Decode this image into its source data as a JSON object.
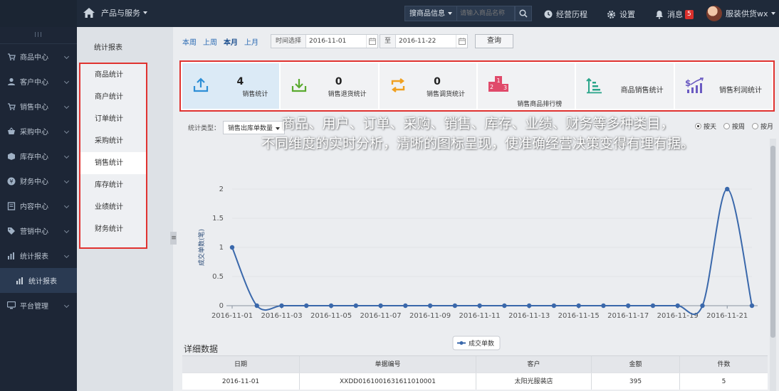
{
  "topbar": {
    "nav_label": "产品与服务",
    "search_category": "搜商品信息",
    "search_placeholder": "请输入商品名称",
    "history_label": "经营历程",
    "settings_label": "设置",
    "messages_label": "消息",
    "messages_count": "5",
    "user_name": "服装供货wx"
  },
  "sidebar": {
    "grip": "III",
    "items": [
      {
        "label": "商品中心",
        "icon": "cart-icon"
      },
      {
        "label": "客户中心",
        "icon": "user-icon"
      },
      {
        "label": "销售中心",
        "icon": "shopping-icon"
      },
      {
        "label": "采购中心",
        "icon": "basket-icon"
      },
      {
        "label": "库存中心",
        "icon": "box-icon"
      },
      {
        "label": "财务中心",
        "icon": "yen-icon"
      },
      {
        "label": "内容中心",
        "icon": "doc-icon"
      },
      {
        "label": "营销中心",
        "icon": "tag-icon"
      },
      {
        "label": "统计报表",
        "icon": "chart-icon"
      }
    ],
    "sub_item": "统计报表",
    "last_item": "平台管理"
  },
  "submenu": {
    "title": "统计报表",
    "items": [
      "商品统计",
      "商户统计",
      "订单统计",
      "采购统计",
      "销售统计",
      "库存统计",
      "业绩统计",
      "财务统计"
    ],
    "active_index": 4
  },
  "filters": {
    "quick": [
      "本周",
      "上周",
      "本月",
      "上月"
    ],
    "active_quick": "本月",
    "date_label": "时间选择",
    "start_date": "2016-11-01",
    "to_label": "至",
    "end_date": "2016-11-22",
    "query_label": "查询"
  },
  "stats": [
    {
      "value": "4",
      "label": "销售统计",
      "icon": "upload-icon",
      "color": "#2e8fd6"
    },
    {
      "value": "0",
      "label": "销售退货统计",
      "icon": "download-icon",
      "color": "#5aaa2f"
    },
    {
      "value": "0",
      "label": "销售调货统计",
      "icon": "swap-icon",
      "color": "#f0a020"
    },
    {
      "value": "",
      "label": "销售商品排行榜",
      "icon": "podium-icon",
      "color": "#e04a6a"
    },
    {
      "value": "",
      "label": "商品销售统计",
      "icon": "bar-sort-icon",
      "color": "#2aa58a"
    },
    {
      "value": "",
      "label": "销售利润统计",
      "icon": "profit-icon",
      "color": "#6b5bc2"
    }
  ],
  "type_row": {
    "label": "统计类型：",
    "selected": "销售出库单数量"
  },
  "radios": [
    {
      "label": "按天",
      "checked": true
    },
    {
      "label": "按周",
      "checked": false
    },
    {
      "label": "按月",
      "checked": false
    }
  ],
  "overlay": {
    "line1": "商品、用户、订单、采购、销售、库存、业绩、财务等多种类目，",
    "line2": "不同维度的实时分析，清晰的图标呈现，使准确经营决策变得有理有据。"
  },
  "chart_data": {
    "type": "line",
    "title": "",
    "ylabel": "成交单数(笔)",
    "xlabel": "",
    "legend": "成交单数",
    "ylim": [
      0,
      2
    ],
    "yticks": [
      0,
      0.5,
      1,
      1.5,
      2
    ],
    "x": [
      "2016-11-01",
      "2016-11-02",
      "2016-11-03",
      "2016-11-04",
      "2016-11-05",
      "2016-11-06",
      "2016-11-07",
      "2016-11-08",
      "2016-11-09",
      "2016-11-10",
      "2016-11-11",
      "2016-11-12",
      "2016-11-13",
      "2016-11-14",
      "2016-11-15",
      "2016-11-16",
      "2016-11-17",
      "2016-11-18",
      "2016-11-19",
      "2016-11-20",
      "2016-11-21",
      "2016-11-22"
    ],
    "xtick_labels": [
      "2016-11-01",
      "2016-11-03",
      "2016-11-05",
      "2016-11-07",
      "2016-11-09",
      "2016-11-11",
      "2016-11-13",
      "2016-11-15",
      "2016-11-17",
      "2016-11-19",
      "2016-11-21"
    ],
    "series": [
      {
        "name": "成交单数",
        "color": "#3a68ab",
        "values": [
          1,
          0,
          0,
          0,
          0,
          0,
          0,
          0,
          0,
          0,
          0,
          0,
          0,
          0,
          0,
          0,
          0,
          0,
          0,
          0,
          2,
          0
        ]
      }
    ]
  },
  "detail": {
    "title": "详细数据",
    "columns": [
      "日期",
      "单据编号",
      "客户",
      "金额",
      "件数"
    ],
    "rows": [
      [
        "2016-11-01",
        "XXDD0161001631611010001",
        "太阳光服装店",
        "395",
        "5"
      ]
    ]
  }
}
